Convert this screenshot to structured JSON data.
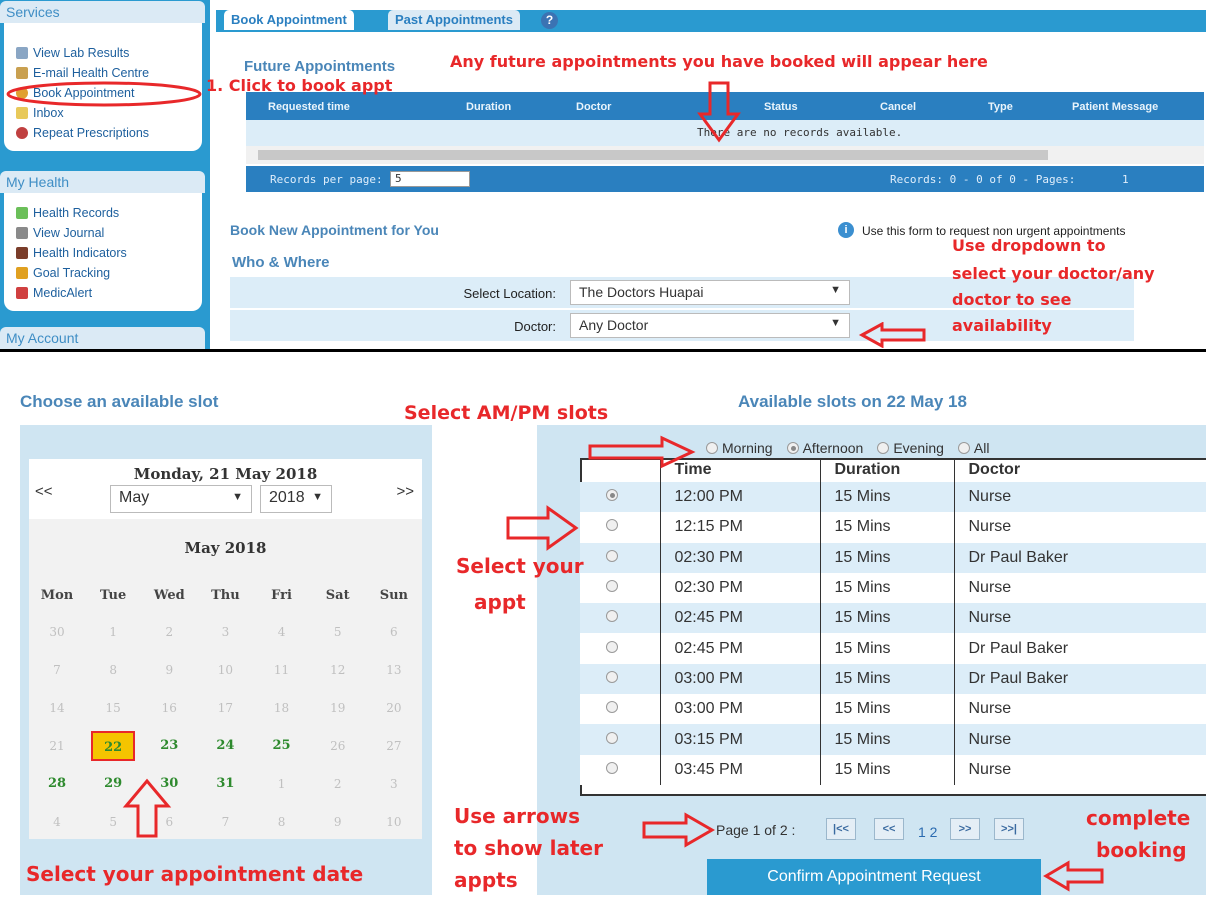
{
  "sidebar": {
    "services_title": "Services",
    "services_items": [
      {
        "label": "View Lab Results",
        "icon": "lab-results-icon"
      },
      {
        "label": "E-mail Health Centre",
        "icon": "email-icon"
      },
      {
        "label": "Book Appointment",
        "icon": "calendar-icon"
      },
      {
        "label": "Inbox",
        "icon": "inbox-icon"
      },
      {
        "label": "Repeat Prescriptions",
        "icon": "prescription-icon"
      }
    ],
    "health_title": "My Health",
    "health_items": [
      {
        "label": "Health Records",
        "icon": "health-records-icon"
      },
      {
        "label": "View Journal",
        "icon": "journal-icon"
      },
      {
        "label": "Health Indicators",
        "icon": "indicators-icon"
      },
      {
        "label": "Goal Tracking",
        "icon": "goal-chart-icon"
      },
      {
        "label": "MedicAlert",
        "icon": "medicalert-icon"
      }
    ],
    "account_title": "My Account"
  },
  "tabs": {
    "book": "Book Appointment",
    "past": "Past Appointments",
    "help": "?"
  },
  "future": {
    "title": "Future Appointments",
    "columns": [
      "Requested time",
      "Duration",
      "Doctor",
      "Status",
      "Cancel",
      "Type",
      "Patient Message"
    ],
    "empty": "There are no records available.",
    "records_per_page_label": "Records per page:",
    "records_per_page": "5",
    "records_summary": "Records: 0 - 0 of 0 - Pages:",
    "pager": "1"
  },
  "book": {
    "title": "Book New Appointment for You",
    "info": "Use this form to request non urgent appointments",
    "who_where": "Who & Where",
    "location_label": "Select Location:",
    "location_value": "The Doctors Huapai",
    "doctor_label": "Doctor:",
    "doctor_value": "Any Doctor"
  },
  "slots": {
    "choose_title": "Choose an available slot",
    "available_title": "Available slots on 22 May 18",
    "filters": [
      "Morning",
      "Afternoon",
      "Evening",
      "All"
    ],
    "selected_filter": "Afternoon",
    "columns": [
      "Time",
      "Duration",
      "Doctor"
    ],
    "rows": [
      {
        "time": "12:00 PM",
        "duration": "15 Mins",
        "doctor": "Nurse",
        "selected": true
      },
      {
        "time": "12:15 PM",
        "duration": "15 Mins",
        "doctor": "Nurse",
        "selected": false
      },
      {
        "time": "02:30 PM",
        "duration": "15 Mins",
        "doctor": "Dr Paul Baker",
        "selected": false
      },
      {
        "time": "02:30 PM",
        "duration": "15 Mins",
        "doctor": "Nurse",
        "selected": false
      },
      {
        "time": "02:45 PM",
        "duration": "15 Mins",
        "doctor": "Nurse",
        "selected": false
      },
      {
        "time": "02:45 PM",
        "duration": "15 Mins",
        "doctor": "Dr Paul Baker",
        "selected": false
      },
      {
        "time": "03:00 PM",
        "duration": "15 Mins",
        "doctor": "Dr Paul Baker",
        "selected": false
      },
      {
        "time": "03:00 PM",
        "duration": "15 Mins",
        "doctor": "Nurse",
        "selected": false
      },
      {
        "time": "03:15 PM",
        "duration": "15 Mins",
        "doctor": "Nurse",
        "selected": false
      },
      {
        "time": "03:45 PM",
        "duration": "15 Mins",
        "doctor": "Nurse",
        "selected": false
      }
    ],
    "page_label": "Page 1 of 2 :",
    "page_links": "1 2",
    "pager_first": "|<<",
    "pager_prev": "<<",
    "pager_next": ">>",
    "pager_last": ">>|",
    "confirm": "Confirm Appointment Request"
  },
  "calendar": {
    "header_date": "Monday, 21 May 2018",
    "prev": "<<",
    "next": ">>",
    "month_select": "May",
    "year_select": "2018",
    "month_title": "May 2018",
    "days_of_week": [
      "Mon",
      "Tue",
      "Wed",
      "Thu",
      "Fri",
      "Sat",
      "Sun"
    ],
    "weeks": [
      [
        "30",
        "1",
        "2",
        "3",
        "4",
        "5",
        "6"
      ],
      [
        "7",
        "8",
        "9",
        "10",
        "11",
        "12",
        "13"
      ],
      [
        "14",
        "15",
        "16",
        "17",
        "18",
        "19",
        "20"
      ],
      [
        "21",
        "22",
        "23",
        "24",
        "25",
        "26",
        "27"
      ],
      [
        "28",
        "29",
        "30",
        "31",
        "1",
        "2",
        "3"
      ],
      [
        "4",
        "5",
        "6",
        "7",
        "8",
        "9",
        "10"
      ]
    ],
    "available": [
      "22",
      "23",
      "24",
      "25",
      "28",
      "29",
      "30",
      "31"
    ],
    "available_week_rows": [
      3,
      4
    ],
    "selected": "22"
  },
  "annotations": {
    "click_to_book": "1. Click to book appt",
    "future_here": "Any future appointments you have booked will appear here",
    "dropdown_line1": "Use dropdown to",
    "dropdown_line2": "select your doctor/any",
    "dropdown_line3": "doctor to see",
    "dropdown_line4": "availability",
    "select_ampm": "Select AM/PM slots",
    "select_appt_1": "Select your",
    "select_appt_2": "appt",
    "select_date": "Select your appointment date",
    "use_arrows_1": "Use arrows",
    "use_arrows_2": "to show later",
    "use_arrows_3": "appts",
    "complete_1": "complete",
    "complete_2": "booking"
  },
  "colors": {
    "brand": "#2a9ad0",
    "annotation": "#e8282a",
    "available": "#2e8a2e",
    "selected_day": "#f5c400"
  }
}
